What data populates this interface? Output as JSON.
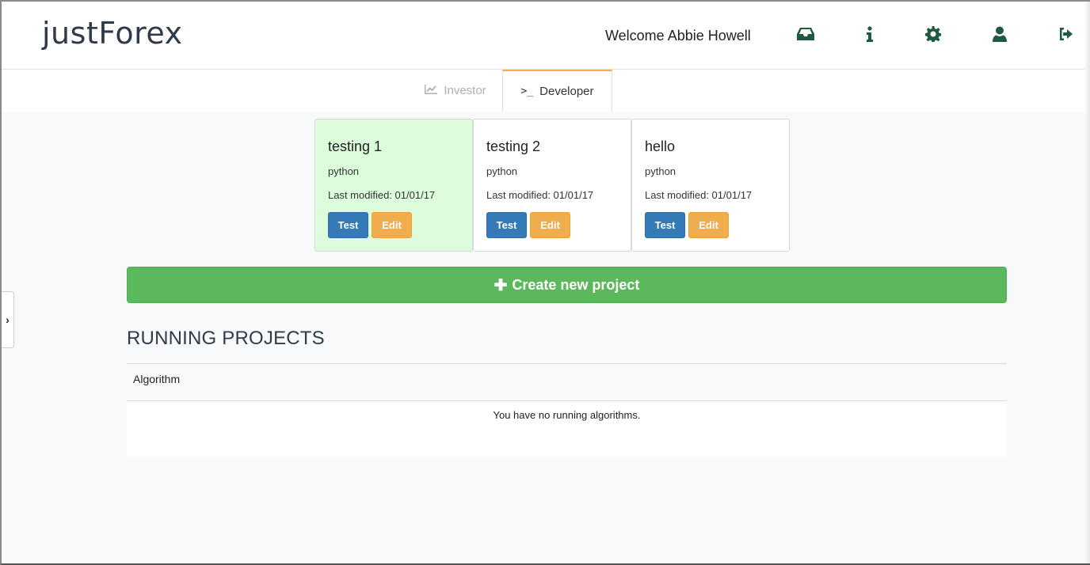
{
  "header": {
    "logo": "justForex",
    "welcome": "Welcome Abbie Howell",
    "icons": [
      "inbox-icon",
      "info-icon",
      "gear-icon",
      "user-icon",
      "sign-out-icon"
    ]
  },
  "tabs": [
    {
      "label": "Investor",
      "icon": "line-chart-icon",
      "active": false
    },
    {
      "label": "Developer",
      "icon": "terminal-icon",
      "active": true
    }
  ],
  "projects": [
    {
      "title": "testing 1",
      "lang": "python",
      "modified": "Last modified: 01/01/17",
      "test": "Test",
      "edit": "Edit",
      "selected": true
    },
    {
      "title": "testing 2",
      "lang": "python",
      "modified": "Last modified: 01/01/17",
      "test": "Test",
      "edit": "Edit",
      "selected": false
    },
    {
      "title": "hello",
      "lang": "python",
      "modified": "Last modified: 01/01/17",
      "test": "Test",
      "edit": "Edit",
      "selected": false
    }
  ],
  "create_button": "Create new project",
  "running": {
    "title": "RUNNING PROJECTS",
    "column": "Algorithm",
    "empty": "You have no running algorithms."
  },
  "colors": {
    "primary": "#337ab7",
    "warning": "#f0ad4e",
    "success": "#5cb85c",
    "selected_card": "#dcfcdc"
  }
}
